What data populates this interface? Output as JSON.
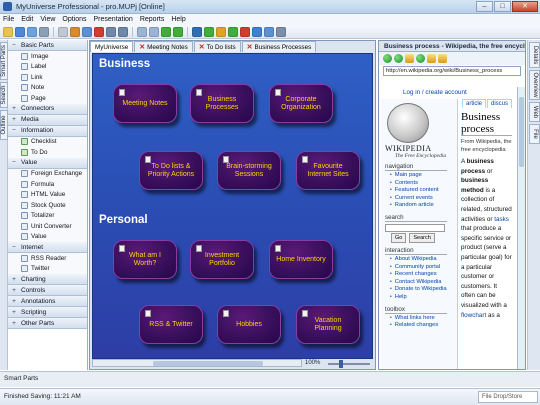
{
  "window": {
    "title": "MyUniverse Professional - pro.MUPj [Online]"
  },
  "menu": [
    "File",
    "Edit",
    "View",
    "Options",
    "Presentation",
    "Reports",
    "Help"
  ],
  "toolbar": {
    "icons": [
      "new-icon",
      "open-icon",
      "save-icon",
      "print-icon",
      "cut-icon",
      "copy-icon",
      "paste-icon",
      "delete-icon",
      "undo-icon",
      "redo-icon",
      "zoom-in-icon",
      "zoom-out-icon",
      "back-icon",
      "forward-icon",
      "globe-icon",
      "web-icon",
      "home-icon",
      "go-icon",
      "stop-icon",
      "refresh-icon",
      "layout-icon",
      "settings-icon"
    ],
    "colors": [
      "#e9c44b",
      "#4a88d8",
      "#6aa3e0",
      "#8aa0b8",
      "#c0c7d2",
      "#d98a2b",
      "#5c8fd6",
      "#d23c2c",
      "#6f87a8",
      "#6f87a8",
      "#9bb3d6",
      "#9bb3d6",
      "#3fae3a",
      "#3fae3a",
      "#2d6fb5",
      "#3fae3a",
      "#e0a329",
      "#3fae3a",
      "#d23c2c",
      "#3f7fd6",
      "#5c8fd6",
      "#7d8ea8"
    ]
  },
  "left_vtabs": [
    "Smart Parts",
    "Search",
    "Outline"
  ],
  "sidepanel": {
    "categories": [
      {
        "sign": "−",
        "label": "Basic Parts",
        "items": [
          "Image",
          "Label",
          "Link",
          "Note",
          "Page"
        ]
      },
      {
        "sign": "+",
        "label": "Connectors",
        "items": []
      },
      {
        "sign": "+",
        "label": "Media",
        "items": []
      },
      {
        "sign": "−",
        "label": "Information",
        "items": [
          "Checklist",
          "To Do"
        ]
      },
      {
        "sign": "−",
        "label": "Value",
        "items": [
          "Foreign Exchange",
          "Formula",
          "HTML Value",
          "Stock Quote",
          "Totalizer",
          "Unit Converter",
          "Value"
        ]
      },
      {
        "sign": "−",
        "label": "Internet",
        "items": [
          "RSS Reader",
          "Twitter"
        ]
      },
      {
        "sign": "+",
        "label": "Charting",
        "items": []
      },
      {
        "sign": "+",
        "label": "Controls",
        "items": []
      },
      {
        "sign": "+",
        "label": "Annotations",
        "items": []
      },
      {
        "sign": "+",
        "label": "Scripting",
        "items": []
      },
      {
        "sign": "+",
        "label": "Other Parts",
        "items": []
      }
    ]
  },
  "doc_tabs": [
    {
      "label": "MyUniverse",
      "active": true,
      "closable": false
    },
    {
      "label": "Meeting Notes",
      "active": false,
      "closable": true
    },
    {
      "label": "To Do lists",
      "active": false,
      "closable": true
    },
    {
      "label": "Business Processes",
      "active": false,
      "closable": true
    }
  ],
  "canvas": {
    "sections": [
      "Business",
      "Personal"
    ],
    "business_nodes": [
      "Meeting Notes",
      "Business Processes",
      "Corporate Organization",
      "To Do lists & Priority Actions",
      "Brain-storming Sessions",
      "Favourite Internet Sites"
    ],
    "personal_nodes": [
      "What am I Worth?",
      "Investment Portfolio",
      "Home Inventory",
      "RSS & Twitter",
      "Hobbies",
      "Vacation Planning"
    ],
    "zoom": "100%",
    "node_text_color": "#ffd400"
  },
  "browser": {
    "title": "Business process - Wikipedia, the free encyclope",
    "url": "http://en.wikipedia.org/wiki/Business_process",
    "login": "Log in / create account",
    "tabs": [
      "article",
      "discus"
    ],
    "logo_word": "WIKIPEDIA",
    "logo_sub": "The Free Encyclopedia",
    "navigation_heading": "navigation",
    "navigation_links": [
      "Main page",
      "Contents",
      "Featured content",
      "Current events",
      "Random article"
    ],
    "search_heading": "search",
    "search_go": "Go",
    "search_search": "Search",
    "interaction_heading": "interaction",
    "interaction_links": [
      "About Wikipedia",
      "Community portal",
      "Recent changes",
      "Contact Wikipedia",
      "Donate to Wikipedia",
      "Help"
    ],
    "toolbox_heading": "toolbox",
    "toolbox_links": [
      "What links here",
      "Related changes"
    ],
    "article_title": "Business process",
    "article_from": "From Wikipedia, the free encyclopedia",
    "article_body": {
      "a": "A ",
      "b1": "business process",
      "or": " or ",
      "b2": "business method",
      "rest1": " is a collection of related, structured activities or ",
      "link": "tasks",
      "rest2": " that produce a specific service or product (serve a particular goal) for a particular customer or customers. It often can be visualized with a ",
      "link2": "flowchart",
      "rest3": " as a"
    }
  },
  "right_vtabs": [
    "Details",
    "Overview",
    "Web",
    "File"
  ],
  "smartparts_bar": "Smart Parts",
  "status": {
    "text": "Finished Saving: 11:21 AM",
    "dropstore": "File Drop/Store"
  }
}
